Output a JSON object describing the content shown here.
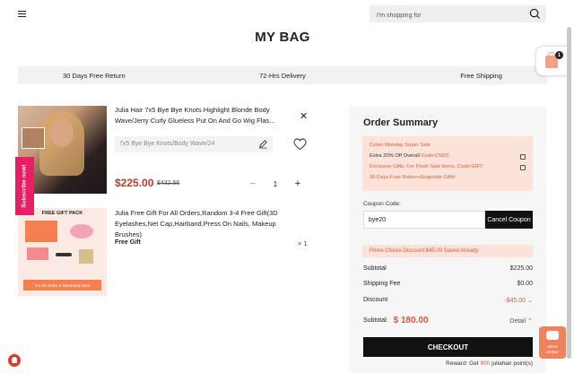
{
  "header": {
    "search_placeholder": "I'm shopping for"
  },
  "page_title": "MY BAG",
  "benefits": [
    "30 Days Free Return",
    "72-Hrs Delivery",
    "Free Shipping"
  ],
  "subscribe_label": "Subscribe now!",
  "bag_count": "1",
  "items": [
    {
      "title": "Julia Hair 7x5 Bye Bye Knots Highlight Blonde Body Wave/Jerry Curly Glueless Put On And Go Wig Flas...",
      "variant": "7x5 Bye Bye Knots/Body Wave/24",
      "price": "$225.00",
      "old_price": "$432.66",
      "quantity": "1"
    },
    {
      "title": "Julia Free Gift For All Orders,Random 3-4 Free Gift(3D Eyelashes,Net Cap,Hairband,Press On Nails, Makeup Brushes)",
      "image_header": "FREE GIFT PACK",
      "image_footer": "For All Order & Randomly Sent",
      "label": "Free Gift",
      "quantity": "× 1"
    }
  ],
  "summary": {
    "title": "Order Summary",
    "promo_lines": [
      "Cyber Monday Super Sale",
      "Extra 20% Off Overall ",
      "Code:CM20",
      "Exclusive Gifts, For Flash Sale Items, Code:GIFT",
      "30 Days Free Return+Exquisite Gifts!"
    ],
    "coupon_label": "Coupon Code:",
    "coupon_value": "bye20",
    "coupon_button": "Cancel Coupon",
    "discount_note": "Prime Choice Discount:$45.00 Saved Already",
    "rows": [
      {
        "label": "Subtotal",
        "value": "$225.00"
      },
      {
        "label": "Shipping Fee",
        "value": "$0.00"
      },
      {
        "label": "Discount",
        "value": "-$45.00"
      }
    ],
    "subtotal_label": "Subtotal:",
    "subtotal_amount": "$ 180.00",
    "detail_label": "Detail",
    "checkout_label": "CHECKOUT",
    "reward_prefix": "Reward: Get ",
    "reward_points": "900",
    "reward_suffix": " juliahair point(s)"
  },
  "chat_label_1": "We're",
  "chat_label_2": "Online",
  "colors": {
    "accent": "#e2583a",
    "price_red": "#c0392b",
    "subscribe_pink": "#e91e63",
    "promo_bg": "#fbe3da"
  }
}
